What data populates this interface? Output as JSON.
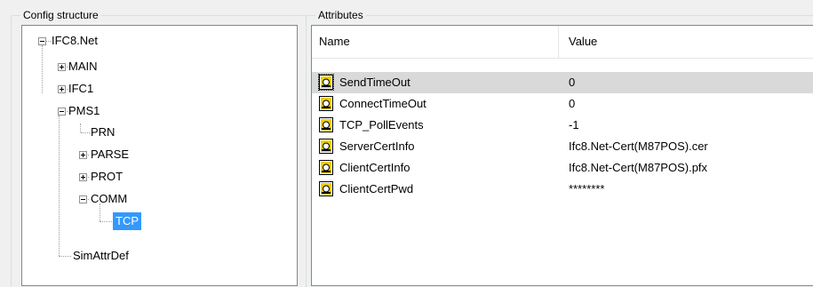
{
  "config_structure": {
    "title": "Config structure",
    "nodes": [
      {
        "label": "IFC8.Net"
      },
      {
        "label": "MAIN"
      },
      {
        "label": "IFC1"
      },
      {
        "label": "PMS1"
      },
      {
        "label": "PRN"
      },
      {
        "label": "PARSE"
      },
      {
        "label": "PROT"
      },
      {
        "label": "COMM"
      },
      {
        "label": "TCP"
      },
      {
        "label": "SimAttrDef"
      }
    ]
  },
  "attributes": {
    "title": "Attributes",
    "columns": {
      "name": "Name",
      "value": "Value"
    },
    "rows": [
      {
        "name": "SendTimeOut",
        "value": "0"
      },
      {
        "name": "ConnectTimeOut",
        "value": "0"
      },
      {
        "name": "TCP_PollEvents",
        "value": "-1"
      },
      {
        "name": "ServerCertInfo",
        "value": "Ifc8.Net-Cert(M87POS).cer"
      },
      {
        "name": "ClientCertInfo",
        "value": "Ifc8.Net-Cert(M87POS).pfx"
      },
      {
        "name": "ClientCertPwd",
        "value": "********"
      }
    ]
  },
  "colors": {
    "selection": "#3399ff",
    "row_selected": "#d9d9d9",
    "icon_yellow": "#f0d000"
  }
}
